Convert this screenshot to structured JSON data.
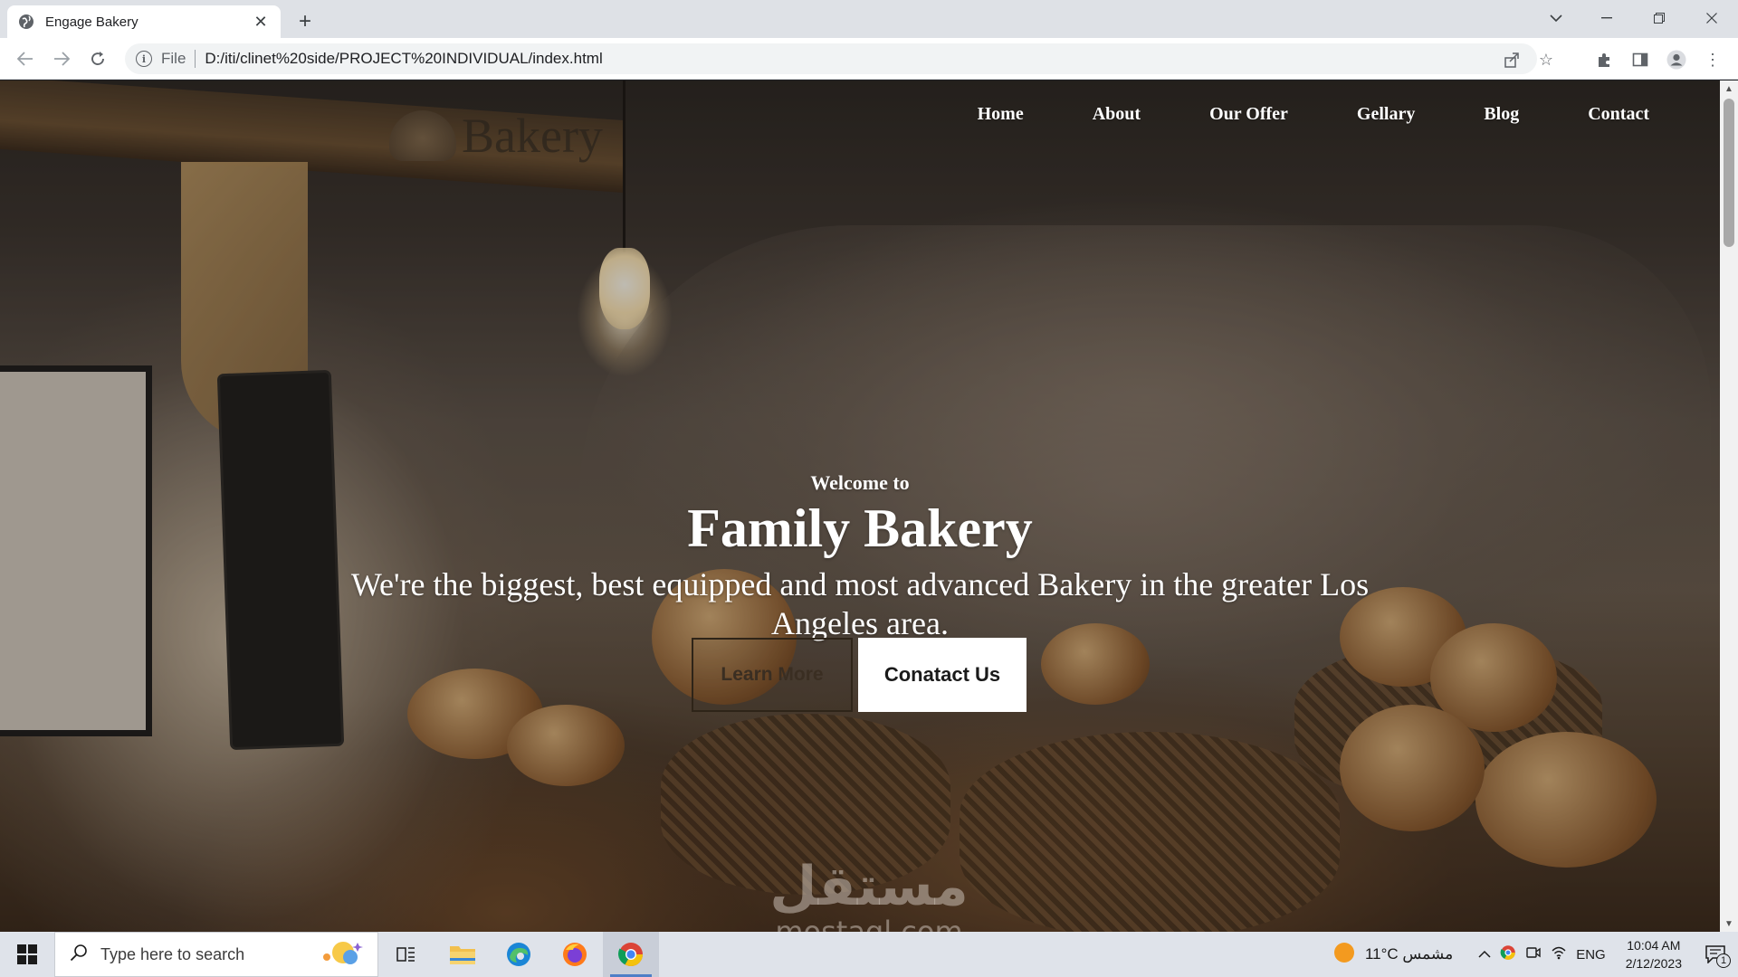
{
  "browser": {
    "tab_title": "Engage Bakery",
    "url_scheme": "File",
    "url": "D:/iti/clinet%20side/PROJECT%20INDIVIDUAL/index.html"
  },
  "site": {
    "logo_text": "Bakery",
    "nav": [
      "Home",
      "About",
      "Our Offer",
      "Gellary",
      "Blog",
      "Contact"
    ],
    "hero": {
      "kicker": "Welcome to",
      "title": "Family Bakery",
      "subtitle": "We're the biggest, best equipped and most advanced Bakery in the greater Los Angeles area.",
      "btn_secondary": "Learn More",
      "btn_primary": "Conatact Us"
    }
  },
  "watermark": {
    "arabic": "مستقل",
    "latin": "mostaql.com"
  },
  "taskbar": {
    "search_placeholder": "Type here to search",
    "weather": "11°C مشمس",
    "language": "ENG",
    "time": "10:04 AM",
    "date": "2/12/2023",
    "notification_count": "1"
  }
}
